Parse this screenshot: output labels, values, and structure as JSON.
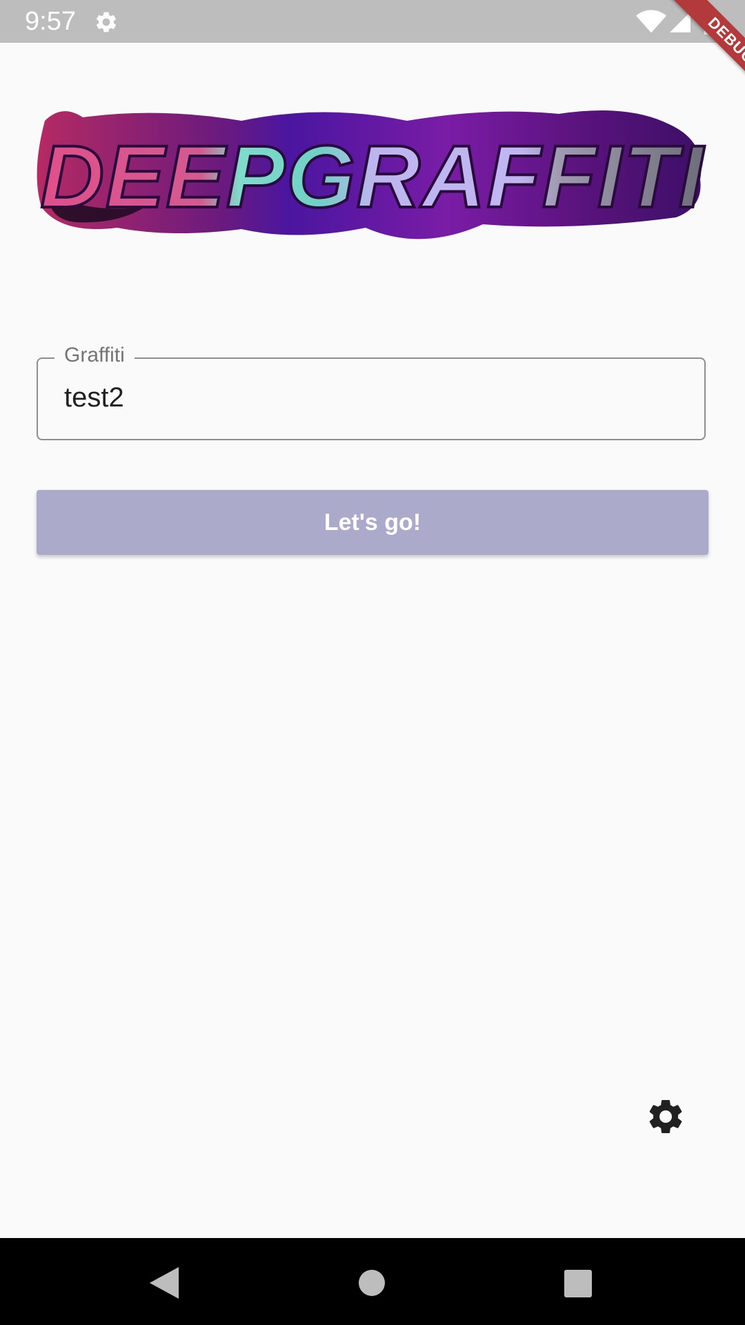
{
  "status_bar": {
    "time": "9:57",
    "icons": [
      "settings-icon",
      "wifi-icon",
      "signal-icon",
      "battery-icon"
    ],
    "debug_label": "DEBUG"
  },
  "logo": {
    "text": "DEEPGRAFFITI",
    "colors": [
      "#c2336a",
      "#6fd9c4",
      "#b7b2ef",
      "#4b0f7a",
      "#2a0b3d"
    ]
  },
  "form": {
    "field_label": "Graffiti",
    "field_value": "test2",
    "submit_label": "Let's go!"
  },
  "colors": {
    "background": "#fafafa",
    "status_bar": "#bdbdbd",
    "button": "#abaacb",
    "debug_ribbon": "#b23a3a"
  },
  "floating": {
    "settings_icon": "settings-icon"
  },
  "nav_bar": {
    "buttons": [
      "back-icon",
      "home-icon",
      "recents-icon"
    ]
  }
}
